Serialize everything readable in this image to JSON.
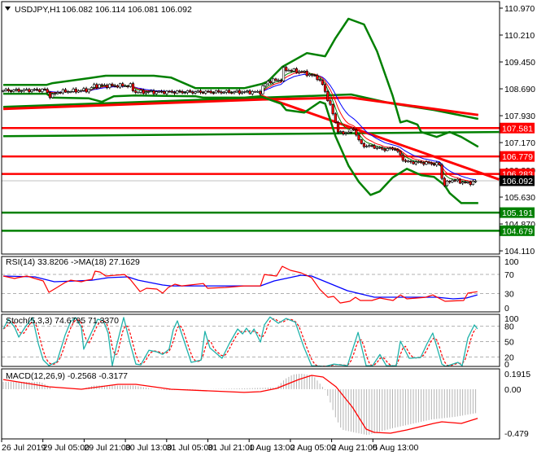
{
  "header": {
    "symbol": "USDJPY,H1",
    "ohlc": "106.082 106.114 106.081 106.092"
  },
  "colors": {
    "bull_body": "#ffffff",
    "bear_body": "#ff0000",
    "wick": "#000000",
    "band": "#008000",
    "support": "#008000",
    "resistance": "#ff0000",
    "ma_fast": "#008000",
    "ma_mid": "#ff0000",
    "ma_slow": "#0000ff",
    "rsi": "#ff0000",
    "rsi_ma": "#0000ff",
    "stoch_main": "#20b2aa",
    "stoch_signal": "#ff0000",
    "macd_hist": "#b4b4b4",
    "macd_signal": "#ff0000",
    "current_price": "#000000"
  },
  "price_axis": {
    "ticks": [
      "110.970",
      "110.210",
      "109.450",
      "108.690",
      "107.930",
      "107.170",
      "106.390",
      "105.630",
      "104.870",
      "104.110"
    ]
  },
  "price_tags": [
    {
      "label": "107.581",
      "value": 107.581,
      "color": "#ff0000"
    },
    {
      "label": "106.779",
      "value": 106.779,
      "color": "#ff0000"
    },
    {
      "label": "106.283",
      "value": 106.283,
      "color": "#ff0000"
    },
    {
      "label": "105.191",
      "value": 105.191,
      "color": "#008000"
    },
    {
      "label": "104.679",
      "value": 104.679,
      "color": "#008000"
    }
  ],
  "current_price": {
    "label": "106.092",
    "value": 106.092,
    "color": "#000000"
  },
  "indicators": {
    "rsi": {
      "label": "RSI(14) 33.8206  ->MA(18) 27.1629",
      "ticks": [
        "100",
        "70",
        "30",
        "0"
      ]
    },
    "stoch": {
      "label": "Stoch(5,3,3) 74.6795 71.3370",
      "ticks": [
        "100",
        "80",
        "50",
        "20",
        "0"
      ]
    },
    "macd": {
      "label": "MACD(12,26,9) -0.2568 -0.3177",
      "ticks": [
        "0.1915",
        "0.00",
        "-0.479"
      ]
    }
  },
  "time_axis": [
    "26 Jul 2019",
    "29 Jul 05:00",
    "29 Jul 21:00",
    "30 Jul 13:00",
    "31 Jul 05:00",
    "31 Jul 21:00",
    "1 Aug 13:00",
    "2 Aug 05:00",
    "2 Aug 21:00",
    "5 Aug 13:00"
  ],
  "chart_data": {
    "type": "candlestick",
    "title": "USDJPY,H1",
    "x_unit": "bar index (1 bar = 1 hour)",
    "bars": 183,
    "ylim": [
      104.11,
      110.97
    ],
    "close": [
      [
        0,
        108.64
      ],
      [
        16.6,
        108.66
      ],
      [
        17.5,
        108.5
      ],
      [
        18.5,
        108.47
      ],
      [
        20.7,
        108.6
      ],
      [
        33,
        108.66
      ],
      [
        35,
        108.78
      ],
      [
        49,
        108.78
      ],
      [
        50.5,
        108.6
      ],
      [
        77,
        108.6
      ],
      [
        99,
        108.6
      ],
      [
        100,
        108.74
      ],
      [
        102,
        108.9
      ],
      [
        107,
        108.95
      ],
      [
        108,
        109.24
      ],
      [
        115,
        109.17
      ],
      [
        121,
        109.01
      ],
      [
        123,
        108.8
      ],
      [
        126,
        108.21
      ],
      [
        129,
        107.51
      ],
      [
        130.4,
        107.4
      ],
      [
        135,
        107.55
      ],
      [
        138,
        107.1
      ],
      [
        143,
        107.05
      ],
      [
        146,
        106.98
      ],
      [
        151,
        107.0
      ],
      [
        154,
        106.7
      ],
      [
        155.5,
        106.62
      ],
      [
        162,
        106.6
      ],
      [
        168,
        106.55
      ],
      [
        169.6,
        105.95
      ],
      [
        172.7,
        106.12
      ],
      [
        179,
        106.02
      ],
      [
        182.8,
        106.09
      ]
    ],
    "bollinger_upper": [
      [
        0,
        108.8
      ],
      [
        16.6,
        108.8
      ],
      [
        19,
        108.85
      ],
      [
        33,
        108.99
      ],
      [
        39.5,
        109.06
      ],
      [
        58,
        109.06
      ],
      [
        64.6,
        109.01
      ],
      [
        74,
        108.71
      ],
      [
        93,
        108.71
      ],
      [
        99.7,
        108.83
      ],
      [
        102,
        108.9
      ],
      [
        107.5,
        109.31
      ],
      [
        117,
        109.7
      ],
      [
        124,
        109.61
      ],
      [
        128,
        110.12
      ],
      [
        133,
        110.67
      ],
      [
        139,
        110.51
      ],
      [
        144,
        109.75
      ],
      [
        150,
        108.5
      ],
      [
        153,
        107.74
      ],
      [
        155.5,
        107.79
      ],
      [
        159.6,
        107.68
      ],
      [
        161,
        107.47
      ],
      [
        167,
        107.33
      ],
      [
        172,
        107.47
      ],
      [
        176.5,
        107.33
      ],
      [
        183,
        107.05
      ]
    ],
    "bollinger_lower": [
      [
        0,
        108.55
      ],
      [
        16.6,
        108.55
      ],
      [
        19,
        108.44
      ],
      [
        33,
        108.42
      ],
      [
        38,
        108.32
      ],
      [
        42.6,
        108.48
      ],
      [
        50.5,
        108.5
      ],
      [
        74,
        108.48
      ],
      [
        77,
        108.44
      ],
      [
        93,
        108.44
      ],
      [
        99,
        108.48
      ],
      [
        107,
        108.27
      ],
      [
        109,
        108.09
      ],
      [
        116,
        108.02
      ],
      [
        122,
        108.32
      ],
      [
        124,
        108.27
      ],
      [
        128,
        107.35
      ],
      [
        133,
        106.52
      ],
      [
        137,
        106.06
      ],
      [
        141.5,
        105.69
      ],
      [
        145,
        105.79
      ],
      [
        150,
        106.18
      ],
      [
        155.5,
        106.43
      ],
      [
        161,
        106.25
      ],
      [
        166,
        106.2
      ],
      [
        170,
        105.97
      ],
      [
        172,
        105.74
      ],
      [
        176.5,
        105.46
      ],
      [
        183,
        105.46
      ]
    ],
    "slow_ma_green": [
      [
        0,
        108.18
      ],
      [
        100,
        108.44
      ],
      [
        134,
        108.53
      ],
      [
        150,
        108.27
      ],
      [
        166,
        108.09
      ],
      [
        183,
        107.84
      ]
    ],
    "slow_ma_red": [
      [
        0,
        108.12
      ],
      [
        100,
        108.39
      ],
      [
        134,
        108.44
      ],
      [
        183,
        107.95
      ]
    ],
    "long_green_line": [
      [
        0,
        107.35
      ],
      [
        191,
        107.47
      ]
    ],
    "trendline_red": [
      [
        99,
        108.5
      ],
      [
        191,
        106.13
      ]
    ],
    "horizontal_levels": [
      {
        "price": 107.581,
        "kind": "resistance"
      },
      {
        "price": 106.779,
        "kind": "resistance"
      },
      {
        "price": 106.283,
        "kind": "resistance"
      },
      {
        "price": 105.191,
        "kind": "support"
      },
      {
        "price": 104.679,
        "kind": "support"
      }
    ],
    "rsi": [
      [
        0,
        66.7
      ],
      [
        4.4,
        61.5
      ],
      [
        5.6,
        63.2
      ],
      [
        9.1,
        66.7
      ],
      [
        12.2,
        61.5
      ],
      [
        15.4,
        56.4
      ],
      [
        17.6,
        32.5
      ],
      [
        19.7,
        39.3
      ],
      [
        23.8,
        53
      ],
      [
        26,
        58
      ],
      [
        30.1,
        54.7
      ],
      [
        32.3,
        58
      ],
      [
        34.2,
        59.8
      ],
      [
        35.4,
        77
      ],
      [
        37.3,
        75
      ],
      [
        39.5,
        66.7
      ],
      [
        42.6,
        68
      ],
      [
        46.7,
        70
      ],
      [
        48.9,
        59.8
      ],
      [
        52.7,
        34
      ],
      [
        55.2,
        41
      ],
      [
        59.2,
        39.3
      ],
      [
        61.4,
        30.8
      ],
      [
        63.6,
        42.7
      ],
      [
        66.1,
        49.6
      ],
      [
        68.7,
        46
      ],
      [
        77.1,
        51
      ],
      [
        78.7,
        41
      ],
      [
        85.6,
        42.7
      ],
      [
        92.8,
        46
      ],
      [
        99.1,
        46
      ],
      [
        100.6,
        70
      ],
      [
        105.3,
        66.7
      ],
      [
        107.5,
        87
      ],
      [
        110.7,
        78.6
      ],
      [
        114.7,
        73.5
      ],
      [
        118.8,
        63
      ],
      [
        121.9,
        39
      ],
      [
        125.1,
        22
      ],
      [
        127.3,
        24
      ],
      [
        129.8,
        10
      ],
      [
        133.5,
        13.7
      ],
      [
        135.7,
        22
      ],
      [
        137.6,
        15.4
      ],
      [
        142,
        15.4
      ],
      [
        145.1,
        20.5
      ],
      [
        150.2,
        15.4
      ],
      [
        153,
        27
      ],
      [
        155.5,
        18.8
      ],
      [
        162.7,
        22
      ],
      [
        165.5,
        27
      ],
      [
        170.2,
        13.7
      ],
      [
        177.4,
        15.4
      ],
      [
        179,
        30.8
      ],
      [
        182.7,
        33.8
      ]
    ],
    "rsi_ma": [
      [
        0,
        66.7
      ],
      [
        12.2,
        65
      ],
      [
        19.7,
        54.7
      ],
      [
        28,
        56.4
      ],
      [
        34.2,
        58
      ],
      [
        40.4,
        63.2
      ],
      [
        48,
        65
      ],
      [
        52,
        58
      ],
      [
        61.4,
        47.9
      ],
      [
        64.6,
        46
      ],
      [
        99.1,
        46
      ],
      [
        104.4,
        56.4
      ],
      [
        114.7,
        68.4
      ],
      [
        118.8,
        66.7
      ],
      [
        132.6,
        35.9
      ],
      [
        143,
        22.2
      ],
      [
        167,
        22.2
      ],
      [
        173.3,
        18.8
      ],
      [
        178.4,
        20.5
      ],
      [
        182.7,
        27.2
      ]
    ],
    "rsi_levels": [
      70,
      30
    ],
    "stoch_main": [
      [
        0,
        74.6
      ],
      [
        2,
        93.7
      ],
      [
        4.4,
        77.8
      ],
      [
        6,
        58.7
      ],
      [
        8.8,
        81
      ],
      [
        11.3,
        96.8
      ],
      [
        13.5,
        46
      ],
      [
        15.4,
        14.3
      ],
      [
        17.6,
        3.2
      ],
      [
        20.7,
        11
      ],
      [
        23.8,
        62
      ],
      [
        26,
        89
      ],
      [
        27.9,
        96.8
      ],
      [
        30.1,
        77.8
      ],
      [
        31,
        35
      ],
      [
        33.9,
        66.7
      ],
      [
        36.4,
        93.7
      ],
      [
        38.6,
        90.5
      ],
      [
        40.4,
        66.7
      ],
      [
        42,
        3
      ],
      [
        43.6,
        41
      ],
      [
        46.4,
        97
      ],
      [
        48.9,
        46
      ],
      [
        51.1,
        6
      ],
      [
        53,
        4.8
      ],
      [
        56.1,
        33
      ],
      [
        59.2,
        30
      ],
      [
        61.4,
        25
      ],
      [
        63.9,
        35
      ],
      [
        65.5,
        73
      ],
      [
        67.1,
        90.5
      ],
      [
        72.4,
        9.5
      ],
      [
        76.2,
        14
      ],
      [
        77.7,
        70
      ],
      [
        79.6,
        38
      ],
      [
        84.3,
        17.5
      ],
      [
        87.1,
        46
      ],
      [
        90.3,
        74.6
      ],
      [
        92.2,
        65
      ],
      [
        93.7,
        76
      ],
      [
        95.3,
        65
      ],
      [
        96.6,
        74.6
      ],
      [
        99.1,
        49
      ],
      [
        100.6,
        82.5
      ],
      [
        102.8,
        98
      ],
      [
        106,
        85.7
      ],
      [
        109,
        95
      ],
      [
        112.5,
        88
      ],
      [
        115.7,
        41
      ],
      [
        118.8,
        3
      ],
      [
        124.1,
        1.6
      ],
      [
        127.3,
        6
      ],
      [
        132.6,
        3
      ],
      [
        136.7,
        68
      ],
      [
        139.8,
        3
      ],
      [
        142.3,
        3
      ],
      [
        145.1,
        25
      ],
      [
        147.6,
        3
      ],
      [
        151.4,
        3
      ],
      [
        153,
        50.8
      ],
      [
        156.4,
        17.5
      ],
      [
        160.8,
        19
      ],
      [
        163.3,
        46
      ],
      [
        165.5,
        66.7
      ],
      [
        169,
        6
      ],
      [
        170.5,
        1.6
      ],
      [
        175.2,
        9.5
      ],
      [
        176.8,
        3
      ],
      [
        179,
        57
      ],
      [
        181.5,
        82.5
      ],
      [
        182.7,
        74.7
      ]
    ],
    "stoch_levels": [
      80,
      50,
      20
    ],
    "macd_hist": [
      [
        0,
        0.08
      ],
      [
        14.4,
        0.08
      ],
      [
        17.6,
        0.03
      ],
      [
        19.1,
        0.0
      ],
      [
        30.1,
        0.0
      ],
      [
        34.8,
        0.04
      ],
      [
        50.5,
        0.04
      ],
      [
        58.3,
        0.0
      ],
      [
        63,
        -0.01
      ],
      [
        92.8,
        0.01
      ],
      [
        105.3,
        0.02
      ],
      [
        108.5,
        0.11
      ],
      [
        111.6,
        0.16
      ],
      [
        114.7,
        0.17
      ],
      [
        119.4,
        0.15
      ],
      [
        122.6,
        0.04
      ],
      [
        124.1,
        -0.01
      ],
      [
        125.7,
        -0.12
      ],
      [
        127.9,
        -0.3
      ],
      [
        130.4,
        -0.44
      ],
      [
        135.1,
        -0.47
      ],
      [
        140.4,
        -0.5
      ],
      [
        142.9,
        -0.48
      ],
      [
        149.2,
        -0.43
      ],
      [
        155.5,
        -0.39
      ],
      [
        164.9,
        -0.33
      ],
      [
        174.3,
        -0.3
      ],
      [
        182.8,
        -0.257
      ]
    ],
    "macd_signal": [
      [
        0,
        0.106
      ],
      [
        17.6,
        0.027
      ],
      [
        30.1,
        0.0
      ],
      [
        44.2,
        0.053
      ],
      [
        51.1,
        0.053
      ],
      [
        64.6,
        0.0
      ],
      [
        92.8,
        -0.035
      ],
      [
        99.1,
        -0.027
      ],
      [
        105.3,
        0.009
      ],
      [
        113.8,
        0.106
      ],
      [
        118.8,
        0.151
      ],
      [
        123.2,
        0.133
      ],
      [
        128.2,
        0.027
      ],
      [
        134.5,
        -0.195
      ],
      [
        139.8,
        -0.435
      ],
      [
        142.9,
        -0.47
      ],
      [
        149.2,
        -0.479
      ],
      [
        155.5,
        -0.444
      ],
      [
        165.8,
        -0.373
      ],
      [
        169,
        -0.355
      ],
      [
        176.5,
        -0.373
      ],
      [
        182.8,
        -0.318
      ]
    ]
  }
}
